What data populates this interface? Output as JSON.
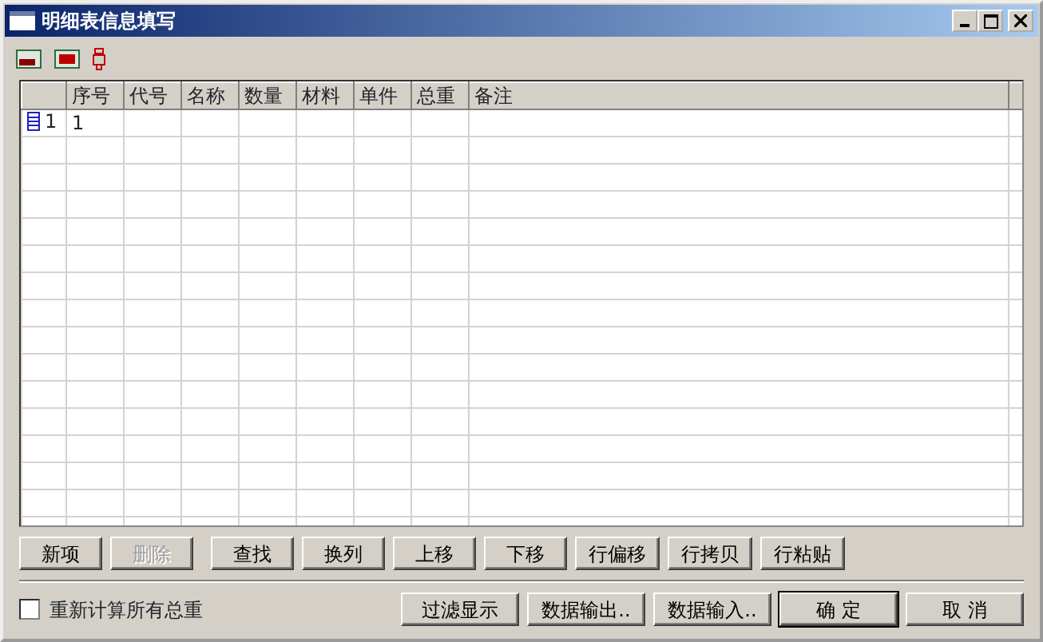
{
  "window": {
    "title": "明细表信息填写"
  },
  "toolbar": [
    {
      "kind": "panel"
    },
    {
      "kind": "panel-red"
    },
    {
      "kind": "pin"
    }
  ],
  "table": {
    "columns": [
      "序号",
      "代号",
      "名称",
      "数量",
      "材料",
      "单件",
      "总重",
      "备注"
    ],
    "rows": [
      {
        "row_header": "1",
        "cells": [
          "1",
          "",
          "",
          "",
          "",
          "",
          "",
          ""
        ]
      }
    ]
  },
  "row_buttons": [
    {
      "label": "新项",
      "disabled": false
    },
    {
      "label": "删除",
      "disabled": true
    },
    {
      "label": "查找",
      "disabled": false
    },
    {
      "label": "换列",
      "disabled": false
    },
    {
      "label": "上移",
      "disabled": false
    },
    {
      "label": "下移",
      "disabled": false
    },
    {
      "label": "行偏移",
      "disabled": false
    },
    {
      "label": "行拷贝",
      "disabled": false
    },
    {
      "label": "行粘贴",
      "disabled": false
    }
  ],
  "recalc": {
    "label": "重新计算所有总重",
    "checked": false
  },
  "dialog_buttons": [
    {
      "label": "过滤显示",
      "default": false
    },
    {
      "label": "数据输出..",
      "default": false
    },
    {
      "label": "数据输入..",
      "default": false
    },
    {
      "label": "确 定",
      "default": true
    },
    {
      "label": "取 消",
      "default": false
    }
  ]
}
